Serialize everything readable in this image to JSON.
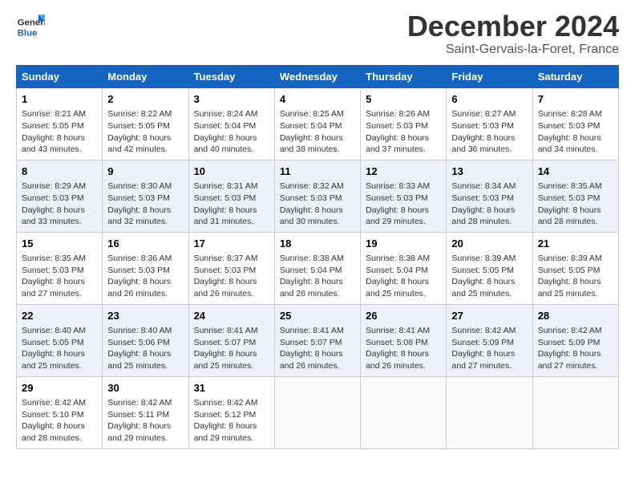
{
  "header": {
    "logo_line1": "General",
    "logo_line2": "Blue",
    "month": "December 2024",
    "location": "Saint-Gervais-la-Foret, France"
  },
  "weekdays": [
    "Sunday",
    "Monday",
    "Tuesday",
    "Wednesday",
    "Thursday",
    "Friday",
    "Saturday"
  ],
  "weeks": [
    [
      {
        "day": "1",
        "sunrise": "Sunrise: 8:21 AM",
        "sunset": "Sunset: 5:05 PM",
        "daylight": "Daylight: 8 hours and 43 minutes."
      },
      {
        "day": "2",
        "sunrise": "Sunrise: 8:22 AM",
        "sunset": "Sunset: 5:05 PM",
        "daylight": "Daylight: 8 hours and 42 minutes."
      },
      {
        "day": "3",
        "sunrise": "Sunrise: 8:24 AM",
        "sunset": "Sunset: 5:04 PM",
        "daylight": "Daylight: 8 hours and 40 minutes."
      },
      {
        "day": "4",
        "sunrise": "Sunrise: 8:25 AM",
        "sunset": "Sunset: 5:04 PM",
        "daylight": "Daylight: 8 hours and 38 minutes."
      },
      {
        "day": "5",
        "sunrise": "Sunrise: 8:26 AM",
        "sunset": "Sunset: 5:03 PM",
        "daylight": "Daylight: 8 hours and 37 minutes."
      },
      {
        "day": "6",
        "sunrise": "Sunrise: 8:27 AM",
        "sunset": "Sunset: 5:03 PM",
        "daylight": "Daylight: 8 hours and 36 minutes."
      },
      {
        "day": "7",
        "sunrise": "Sunrise: 8:28 AM",
        "sunset": "Sunset: 5:03 PM",
        "daylight": "Daylight: 8 hours and 34 minutes."
      }
    ],
    [
      {
        "day": "8",
        "sunrise": "Sunrise: 8:29 AM",
        "sunset": "Sunset: 5:03 PM",
        "daylight": "Daylight: 8 hours and 33 minutes."
      },
      {
        "day": "9",
        "sunrise": "Sunrise: 8:30 AM",
        "sunset": "Sunset: 5:03 PM",
        "daylight": "Daylight: 8 hours and 32 minutes."
      },
      {
        "day": "10",
        "sunrise": "Sunrise: 8:31 AM",
        "sunset": "Sunset: 5:03 PM",
        "daylight": "Daylight: 8 hours and 31 minutes."
      },
      {
        "day": "11",
        "sunrise": "Sunrise: 8:32 AM",
        "sunset": "Sunset: 5:03 PM",
        "daylight": "Daylight: 8 hours and 30 minutes."
      },
      {
        "day": "12",
        "sunrise": "Sunrise: 8:33 AM",
        "sunset": "Sunset: 5:03 PM",
        "daylight": "Daylight: 8 hours and 29 minutes."
      },
      {
        "day": "13",
        "sunrise": "Sunrise: 8:34 AM",
        "sunset": "Sunset: 5:03 PM",
        "daylight": "Daylight: 8 hours and 28 minutes."
      },
      {
        "day": "14",
        "sunrise": "Sunrise: 8:35 AM",
        "sunset": "Sunset: 5:03 PM",
        "daylight": "Daylight: 8 hours and 28 minutes."
      }
    ],
    [
      {
        "day": "15",
        "sunrise": "Sunrise: 8:35 AM",
        "sunset": "Sunset: 5:03 PM",
        "daylight": "Daylight: 8 hours and 27 minutes."
      },
      {
        "day": "16",
        "sunrise": "Sunrise: 8:36 AM",
        "sunset": "Sunset: 5:03 PM",
        "daylight": "Daylight: 8 hours and 26 minutes."
      },
      {
        "day": "17",
        "sunrise": "Sunrise: 8:37 AM",
        "sunset": "Sunset: 5:03 PM",
        "daylight": "Daylight: 8 hours and 26 minutes."
      },
      {
        "day": "18",
        "sunrise": "Sunrise: 8:38 AM",
        "sunset": "Sunset: 5:04 PM",
        "daylight": "Daylight: 8 hours and 26 minutes."
      },
      {
        "day": "19",
        "sunrise": "Sunrise: 8:38 AM",
        "sunset": "Sunset: 5:04 PM",
        "daylight": "Daylight: 8 hours and 25 minutes."
      },
      {
        "day": "20",
        "sunrise": "Sunrise: 8:39 AM",
        "sunset": "Sunset: 5:05 PM",
        "daylight": "Daylight: 8 hours and 25 minutes."
      },
      {
        "day": "21",
        "sunrise": "Sunrise: 8:39 AM",
        "sunset": "Sunset: 5:05 PM",
        "daylight": "Daylight: 8 hours and 25 minutes."
      }
    ],
    [
      {
        "day": "22",
        "sunrise": "Sunrise: 8:40 AM",
        "sunset": "Sunset: 5:05 PM",
        "daylight": "Daylight: 8 hours and 25 minutes."
      },
      {
        "day": "23",
        "sunrise": "Sunrise: 8:40 AM",
        "sunset": "Sunset: 5:06 PM",
        "daylight": "Daylight: 8 hours and 25 minutes."
      },
      {
        "day": "24",
        "sunrise": "Sunrise: 8:41 AM",
        "sunset": "Sunset: 5:07 PM",
        "daylight": "Daylight: 8 hours and 25 minutes."
      },
      {
        "day": "25",
        "sunrise": "Sunrise: 8:41 AM",
        "sunset": "Sunset: 5:07 PM",
        "daylight": "Daylight: 8 hours and 26 minutes."
      },
      {
        "day": "26",
        "sunrise": "Sunrise: 8:41 AM",
        "sunset": "Sunset: 5:08 PM",
        "daylight": "Daylight: 8 hours and 26 minutes."
      },
      {
        "day": "27",
        "sunrise": "Sunrise: 8:42 AM",
        "sunset": "Sunset: 5:09 PM",
        "daylight": "Daylight: 8 hours and 27 minutes."
      },
      {
        "day": "28",
        "sunrise": "Sunrise: 8:42 AM",
        "sunset": "Sunset: 5:09 PM",
        "daylight": "Daylight: 8 hours and 27 minutes."
      }
    ],
    [
      {
        "day": "29",
        "sunrise": "Sunrise: 8:42 AM",
        "sunset": "Sunset: 5:10 PM",
        "daylight": "Daylight: 8 hours and 28 minutes."
      },
      {
        "day": "30",
        "sunrise": "Sunrise: 8:42 AM",
        "sunset": "Sunset: 5:11 PM",
        "daylight": "Daylight: 8 hours and 29 minutes."
      },
      {
        "day": "31",
        "sunrise": "Sunrise: 8:42 AM",
        "sunset": "Sunset: 5:12 PM",
        "daylight": "Daylight: 8 hours and 29 minutes."
      },
      null,
      null,
      null,
      null
    ]
  ]
}
